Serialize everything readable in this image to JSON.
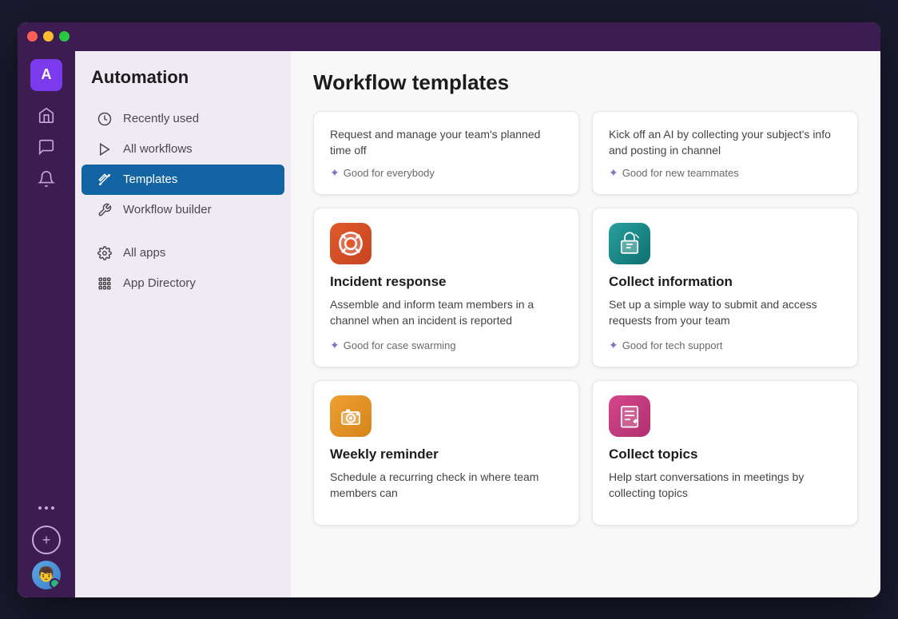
{
  "window": {
    "titlebar": {
      "traffic_lights": [
        "red",
        "yellow",
        "green"
      ]
    }
  },
  "rail": {
    "avatar_label": "A",
    "icons": [
      {
        "name": "home-icon",
        "symbol": "⌂"
      },
      {
        "name": "messages-icon",
        "symbol": "💬"
      },
      {
        "name": "notifications-icon",
        "symbol": "🔔"
      },
      {
        "name": "more-icon",
        "symbol": "···"
      }
    ],
    "add_label": "+",
    "user_face": "👦"
  },
  "sidebar": {
    "title": "Automation",
    "items": [
      {
        "label": "Recently used",
        "icon": "clock",
        "active": false
      },
      {
        "label": "All workflows",
        "icon": "play",
        "active": false
      },
      {
        "label": "Templates",
        "icon": "wand",
        "active": true
      },
      {
        "label": "Workflow builder",
        "icon": "wrench",
        "active": false
      }
    ],
    "section2": [
      {
        "label": "All apps",
        "icon": "gear"
      },
      {
        "label": "App Directory",
        "icon": "grid"
      }
    ]
  },
  "main": {
    "title": "Workflow templates",
    "cards": [
      {
        "id": "time-off",
        "icon_type": "timeoff",
        "icon_emoji": "📅",
        "title": "",
        "description": "Request and manage your team's planned time off",
        "badge": "Good for everybody",
        "partial": true
      },
      {
        "id": "onboarding",
        "icon_type": "onboard",
        "icon_emoji": "🏷",
        "title": "",
        "description": "Kick off an AI by collecting your subject's info and posting in channel",
        "badge": "Good for new teammates",
        "partial": true
      },
      {
        "id": "incident",
        "icon_type": "incident",
        "icon_emoji": "🆘",
        "title": "Incident response",
        "description": "Assemble and inform team members in a channel when an incident is reported",
        "badge": "Good for case swarming",
        "partial": false
      },
      {
        "id": "collect-info",
        "icon_type": "collect",
        "icon_emoji": "📦",
        "title": "Collect information",
        "description": "Set up a simple way to submit and access requests from your team",
        "badge": "Good for tech support",
        "partial": false
      },
      {
        "id": "weekly",
        "icon_type": "weekly",
        "icon_emoji": "📷",
        "title": "Weekly reminder",
        "description": "Schedule a recurring check in where team members can",
        "badge": "",
        "partial": false
      },
      {
        "id": "topics",
        "icon_type": "topics",
        "icon_emoji": "📋",
        "title": "Collect topics",
        "description": "Help start conversations in meetings by collecting topics",
        "badge": "",
        "partial": false
      }
    ]
  }
}
